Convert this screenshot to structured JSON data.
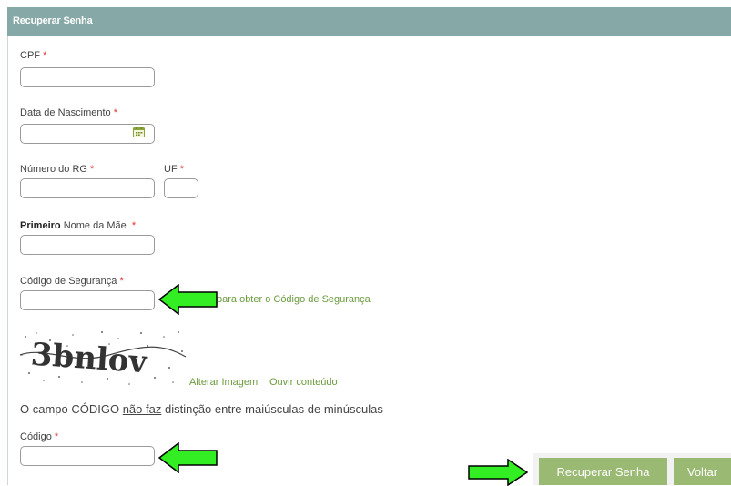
{
  "form": {
    "title": "Recuperar Senha",
    "required_mark": "*",
    "fields": {
      "cpf": {
        "label": "CPF",
        "value": ""
      },
      "birth": {
        "label": "Data de Nascimento",
        "value": ""
      },
      "rg": {
        "label": "Número do RG",
        "value": ""
      },
      "uf": {
        "label": "UF",
        "value": ""
      },
      "mother_bold": "Primeiro",
      "mother_rest": " Nome da Mãe",
      "mother_value": "",
      "security": {
        "label": "Código de Segurança",
        "value": ""
      },
      "code": {
        "label": "Código",
        "value": ""
      }
    },
    "security_link": "para obter o Código de Segurança",
    "captcha_text": "3bnlov",
    "change_image": "Alterar Imagem",
    "listen": "Ouvir conteúdo",
    "note_before": "O campo CÓDIGO ",
    "note_underlined": "não faz",
    "note_after": " distinção entre maiúsculas de minúsculas",
    "buttons": {
      "recover": "Recuperar Senha",
      "back": "Voltar"
    }
  },
  "colors": {
    "header": "#86a8a6",
    "button": "#9aba73",
    "link": "#6b9b3e",
    "arrow": "#33ee22",
    "required": "#e03030"
  },
  "icons": [
    "calendar-icon",
    "arrow-right-icon",
    "arrow-left-icon"
  ]
}
